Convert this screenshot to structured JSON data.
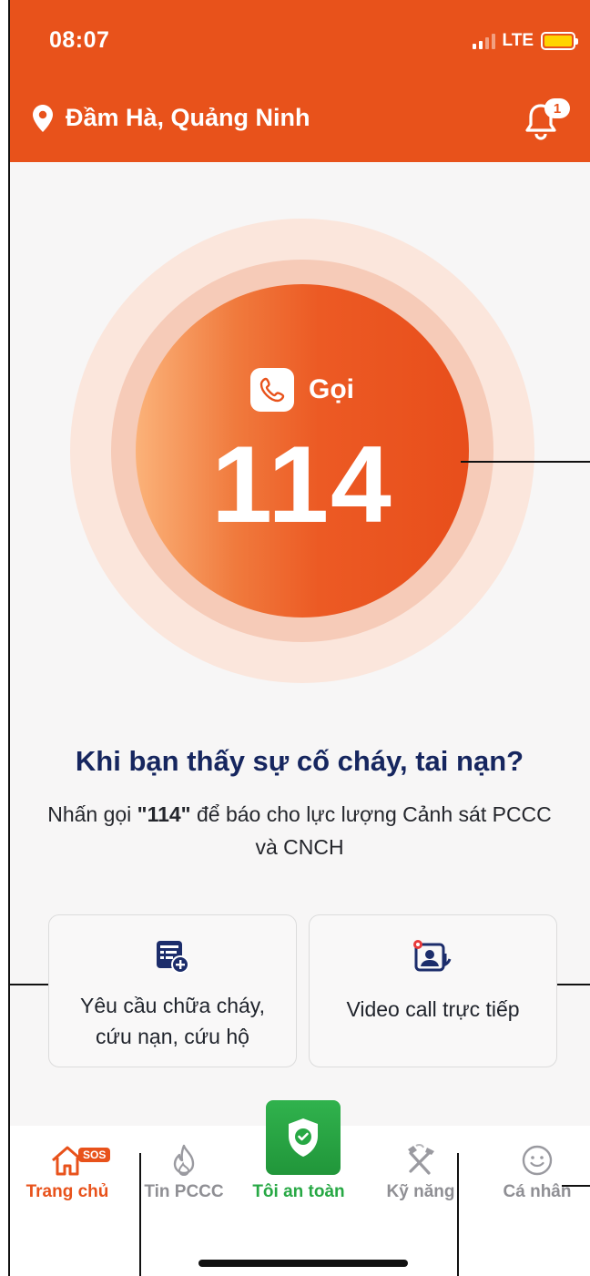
{
  "status_bar": {
    "time": "08:07",
    "network": "LTE"
  },
  "header": {
    "location": "Đầm Hà,  Quảng Ninh",
    "notification_count": "1"
  },
  "call": {
    "label": "Gọi",
    "number": "114"
  },
  "info": {
    "question": "Khi bạn thấy sự cố cháy, tai nạn?",
    "desc_prefix": "Nhấn gọi ",
    "desc_bold": "\"114\"",
    "desc_suffix": " để báo cho lực lượng Cảnh sát PCCC và CNCH"
  },
  "actions": [
    {
      "label": "Yêu cầu chữa cháy, cứu nạn, cứu hộ",
      "icon": "form-plus-icon"
    },
    {
      "label": "Video call trực tiếp",
      "icon": "video-call-icon"
    }
  ],
  "tabs": [
    {
      "label": "Trang chủ",
      "icon": "home-icon",
      "badge": "SOS",
      "active": true
    },
    {
      "label": "Tin PCCC",
      "icon": "fire-icon"
    },
    {
      "label": "Tôi an toàn",
      "icon": "shield-check-icon"
    },
    {
      "label": "Kỹ năng",
      "icon": "tools-icon"
    },
    {
      "label": "Cá nhân",
      "icon": "smiley-icon"
    }
  ],
  "colors": {
    "brand": "#e8521b",
    "safe": "#27a844",
    "heading": "#16265f"
  }
}
